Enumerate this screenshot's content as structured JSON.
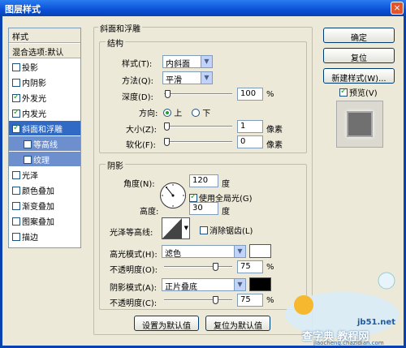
{
  "window": {
    "title": "图层样式",
    "close": "×"
  },
  "styles_list": {
    "items": [
      {
        "label": "样式",
        "checkbox": false,
        "checked": false
      },
      {
        "label": "混合选项:默认",
        "checkbox": false,
        "checked": false
      },
      {
        "label": "投影",
        "checkbox": true,
        "checked": false
      },
      {
        "label": "内阴影",
        "checkbox": true,
        "checked": false
      },
      {
        "label": "外发光",
        "checkbox": true,
        "checked": true
      },
      {
        "label": "内发光",
        "checkbox": true,
        "checked": true
      },
      {
        "label": "斜面和浮雕",
        "checkbox": true,
        "checked": true
      },
      {
        "label": "等高线",
        "checkbox": true,
        "checked": false
      },
      {
        "label": "纹理",
        "checkbox": true,
        "checked": false
      },
      {
        "label": "光泽",
        "checkbox": true,
        "checked": false
      },
      {
        "label": "颜色叠加",
        "checkbox": true,
        "checked": false
      },
      {
        "label": "渐变叠加",
        "checkbox": true,
        "checked": false
      },
      {
        "label": "图案叠加",
        "checkbox": true,
        "checked": false
      },
      {
        "label": "描边",
        "checkbox": true,
        "checked": false
      }
    ]
  },
  "bevel": {
    "title": "斜面和浮雕",
    "structure": {
      "title": "结构",
      "style_label": "样式(T):",
      "style_value": "内斜面",
      "technique_label": "方法(Q):",
      "technique_value": "平滑",
      "depth_label": "深度(D):",
      "depth_value": "100",
      "depth_unit": "%",
      "direction_label": "方向:",
      "dir_up": "上",
      "dir_down": "下",
      "size_label": "大小(Z):",
      "size_value": "1",
      "size_unit": "像素",
      "soften_label": "软化(F):",
      "soften_value": "0",
      "soften_unit": "像素"
    },
    "shading": {
      "title": "阴影",
      "angle_label": "角度(N):",
      "angle_value": "120",
      "angle_unit": "度",
      "global_light_label": "使用全局光(G)",
      "altitude_label": "高度:",
      "altitude_value": "30",
      "altitude_unit": "度",
      "gloss_label": "光泽等高线:",
      "antialias_label": "消除锯齿(L)",
      "highlight_mode_label": "高光模式(H):",
      "highlight_mode_value": "滤色",
      "highlight_color": "#ffffff",
      "highlight_opacity_label": "不透明度(O):",
      "highlight_opacity_value": "75",
      "highlight_opacity_unit": "%",
      "shadow_mode_label": "阴影模式(A):",
      "shadow_mode_value": "正片叠底",
      "shadow_color": "#000000",
      "shadow_opacity_label": "不透明度(C):",
      "shadow_opacity_value": "75",
      "shadow_opacity_unit": "%"
    },
    "make_default": "设置为默认值",
    "reset_default": "复位为默认值"
  },
  "buttons": {
    "ok": "确定",
    "reset": "复位",
    "new_style": "新建样式(W)...",
    "preview": "预览(V)"
  },
  "watermark": {
    "site1": "jb51.net",
    "site2": "查字典 教程网",
    "site3": "jiaocheng.chazidian.com"
  }
}
